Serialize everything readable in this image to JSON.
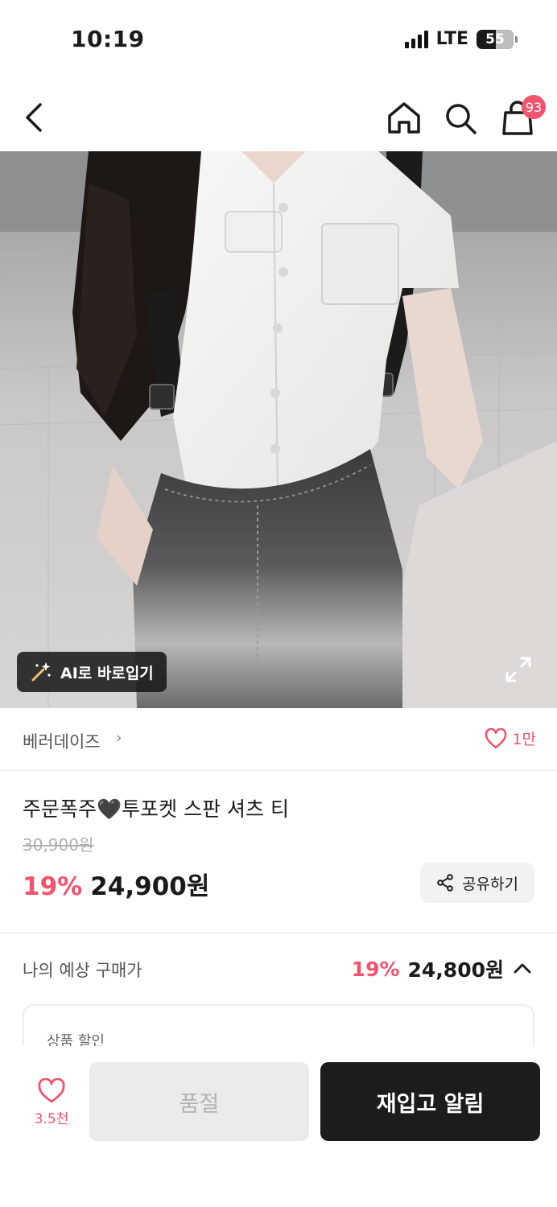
{
  "status_bar": {
    "time": "10:19",
    "network": "LTE",
    "battery": "55"
  },
  "nav": {
    "back_icon": "chevron-left-icon",
    "home_icon": "home-icon",
    "search_icon": "search-icon",
    "bag_icon": "shopping-bag-icon",
    "bag_badge": "93"
  },
  "hero": {
    "ai_button_label": "AI로 바로입기",
    "ai_icon": "magic-wand-icon",
    "expand_icon": "expand-icon"
  },
  "brand": {
    "name": "베러데이즈",
    "chevron": "›",
    "like_count": "1만"
  },
  "product": {
    "title": "주문폭주🖤투포켓 스판 셔츠 티",
    "original_price": "30,900원",
    "discount": "19%",
    "price": "24,900원",
    "share_label": "공유하기"
  },
  "expected": {
    "label": "나의 예상 구매가",
    "discount": "19%",
    "price": "24,800원",
    "card_label": "상품 할인"
  },
  "bottom_bar": {
    "like_count": "3.5천",
    "soldout_label": "품절",
    "restock_label": "재입고 알림"
  },
  "colors": {
    "accent": "#f2536d",
    "dark_button": "#1c1c1c",
    "disabled_button": "#ebebeb"
  }
}
